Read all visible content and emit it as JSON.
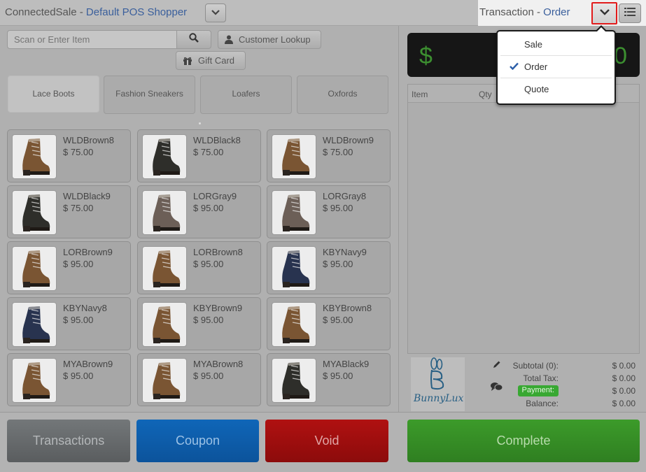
{
  "header": {
    "brand_name": "ConnectedSale -",
    "store_name": "Default POS Shopper",
    "transaction_label": "Transaction -",
    "transaction_type": "Order"
  },
  "search": {
    "placeholder": "Scan or Enter Item",
    "customer_lookup_label": "Customer Lookup",
    "gift_card_label": "Gift Card"
  },
  "categories": [
    {
      "label": "Lace Boots",
      "active": true
    },
    {
      "label": "Fashion Sneakers",
      "active": false
    },
    {
      "label": "Loafers",
      "active": false
    },
    {
      "label": "Oxfords",
      "active": false
    }
  ],
  "products": [
    {
      "name": "WLDBrown8",
      "price": "$ 75.00"
    },
    {
      "name": "WLDBlack8",
      "price": "$ 75.00"
    },
    {
      "name": "WLDBrown9",
      "price": "$ 75.00"
    },
    {
      "name": "WLDBlack9",
      "price": "$ 75.00"
    },
    {
      "name": "LORGray9",
      "price": "$ 95.00"
    },
    {
      "name": "LORGray8",
      "price": "$ 95.00"
    },
    {
      "name": "LORBrown9",
      "price": "$ 95.00"
    },
    {
      "name": "LORBrown8",
      "price": "$ 95.00"
    },
    {
      "name": "KBYNavy9",
      "price": "$ 95.00"
    },
    {
      "name": "KBYNavy8",
      "price": "$ 95.00"
    },
    {
      "name": "KBYBrown9",
      "price": "$ 95.00"
    },
    {
      "name": "KBYBrown8",
      "price": "$ 95.00"
    },
    {
      "name": "MYABrown9",
      "price": "$ 95.00"
    },
    {
      "name": "MYABrown8",
      "price": "$ 95.00"
    },
    {
      "name": "MYABlack9",
      "price": "$ 95.00"
    }
  ],
  "total": {
    "currency": "$",
    "amount": "0"
  },
  "cart": {
    "col_item": "Item",
    "col_qty": "Qty"
  },
  "summary": {
    "logo_text": "BunnyLux",
    "subtotal_label": "Subtotal (0):",
    "subtotal_value": "$ 0.00",
    "tax_label": "Total Tax:",
    "tax_value": "$ 0.00",
    "payment_label": "Payment:",
    "payment_value": "$ 0.00",
    "balance_label": "Balance:",
    "balance_value": "$ 0.00"
  },
  "actions": {
    "transactions": "Transactions",
    "coupon": "Coupon",
    "void": "Void",
    "complete": "Complete"
  },
  "transaction_menu": {
    "items": [
      {
        "label": "Sale",
        "selected": false
      },
      {
        "label": "Order",
        "selected": true
      },
      {
        "label": "Quote",
        "selected": false
      }
    ]
  },
  "colors": {
    "boot_brown": "#7a5533",
    "boot_black": "#2e2e2a",
    "boot_gray": "#6c5f57",
    "boot_navy": "#28334f",
    "accent_blue": "#3a5f9c",
    "highlight_red": "#e21b1b",
    "total_green": "#3c8f30"
  }
}
